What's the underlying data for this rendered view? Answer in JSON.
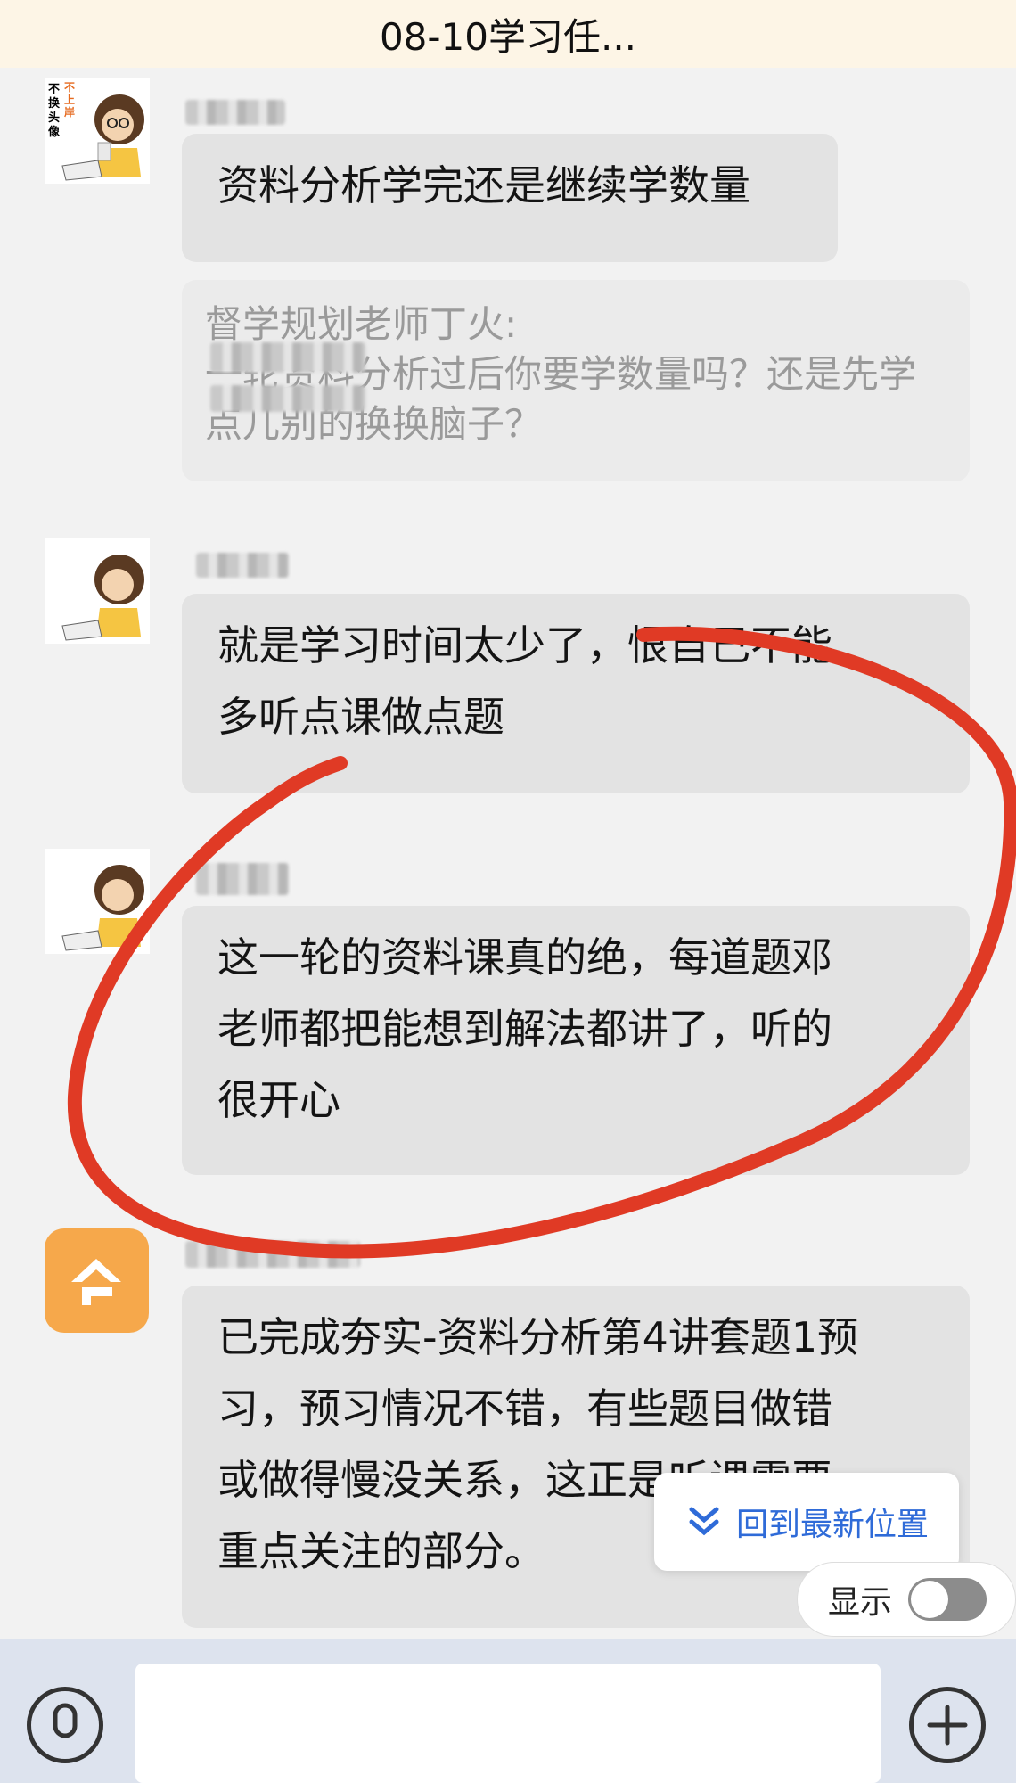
{
  "header": {
    "title": "08-10学习任..."
  },
  "messages": [
    {
      "text": "资料分析学完还是继续学数量"
    },
    {
      "quote_sender": "督学规划老师丁火:",
      "quote_body": "一轮资料分析过后你要学数量吗？还是先学点儿别的换换脑子？"
    },
    {
      "text_line1": "就是学习时间太少了，恨自己不能",
      "text_line2": "多听点课做点题"
    },
    {
      "text_line1": "这一轮的资料课真的绝，每道题邓",
      "text_line2": "老师都把能想到解法都讲了，听的",
      "text_line3": "很开心"
    },
    {
      "text_line1": "已完成夯实-资料分析第4讲套题1预",
      "text_line2": "习，预习情况不错，有些题目做错",
      "text_line3": "或做得慢没关系，这正是听课需要",
      "text_line4": "重点关注的部分。"
    }
  ],
  "avatar": {
    "tag_vertical": "不换头像",
    "tag_orange": "不上岸"
  },
  "scroll_button": {
    "label": "回到最新位置",
    "icon": "double-chevron-down-icon"
  },
  "show_toggle": {
    "label": "显示",
    "state": "off"
  },
  "composer": {
    "voice_icon": "microphone-icon",
    "plus_icon": "plus-icon"
  },
  "colors": {
    "header_bg": "#fdf5e6",
    "bubble": "#e3e3e3",
    "accent_blue": "#2f6bd8",
    "annotation_red": "#e03a25",
    "app_orange": "#f6a84b"
  }
}
